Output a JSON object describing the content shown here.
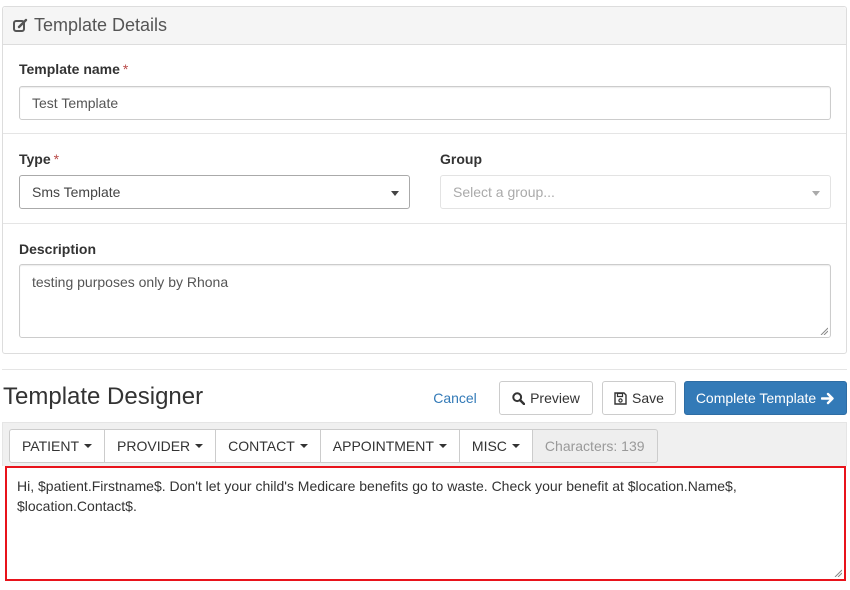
{
  "details": {
    "title": "Template Details",
    "template_name": {
      "label": "Template name",
      "required_mark": "*",
      "value": "Test Template"
    },
    "type": {
      "label": "Type",
      "required_mark": "*",
      "selected": "Sms Template"
    },
    "group": {
      "label": "Group",
      "placeholder": "Select a group..."
    },
    "description": {
      "label": "Description",
      "value": "testing purposes only by Rhona"
    }
  },
  "designer": {
    "title": "Template Designer",
    "cancel_label": "Cancel",
    "preview_label": "Preview",
    "save_label": "Save",
    "complete_label": "Complete Template",
    "toolbar": {
      "menus": [
        "PATIENT",
        "PROVIDER",
        "CONTACT",
        "APPOINTMENT",
        "MISC"
      ],
      "characters_text": "Characters: 139"
    },
    "message": "Hi, $patient.Firstname$. Don't let your child's Medicare benefits go to waste. Check your benefit at  $location.Name$, $location.Contact$."
  },
  "colors": {
    "primary": "#337ab7",
    "editor_border": "#e8131b",
    "required_mark": "#b94a48"
  },
  "icons": {
    "heading": "edit-icon",
    "preview": "search-icon",
    "save": "floppy-disk-icon",
    "complete": "arrow-right-icon"
  }
}
